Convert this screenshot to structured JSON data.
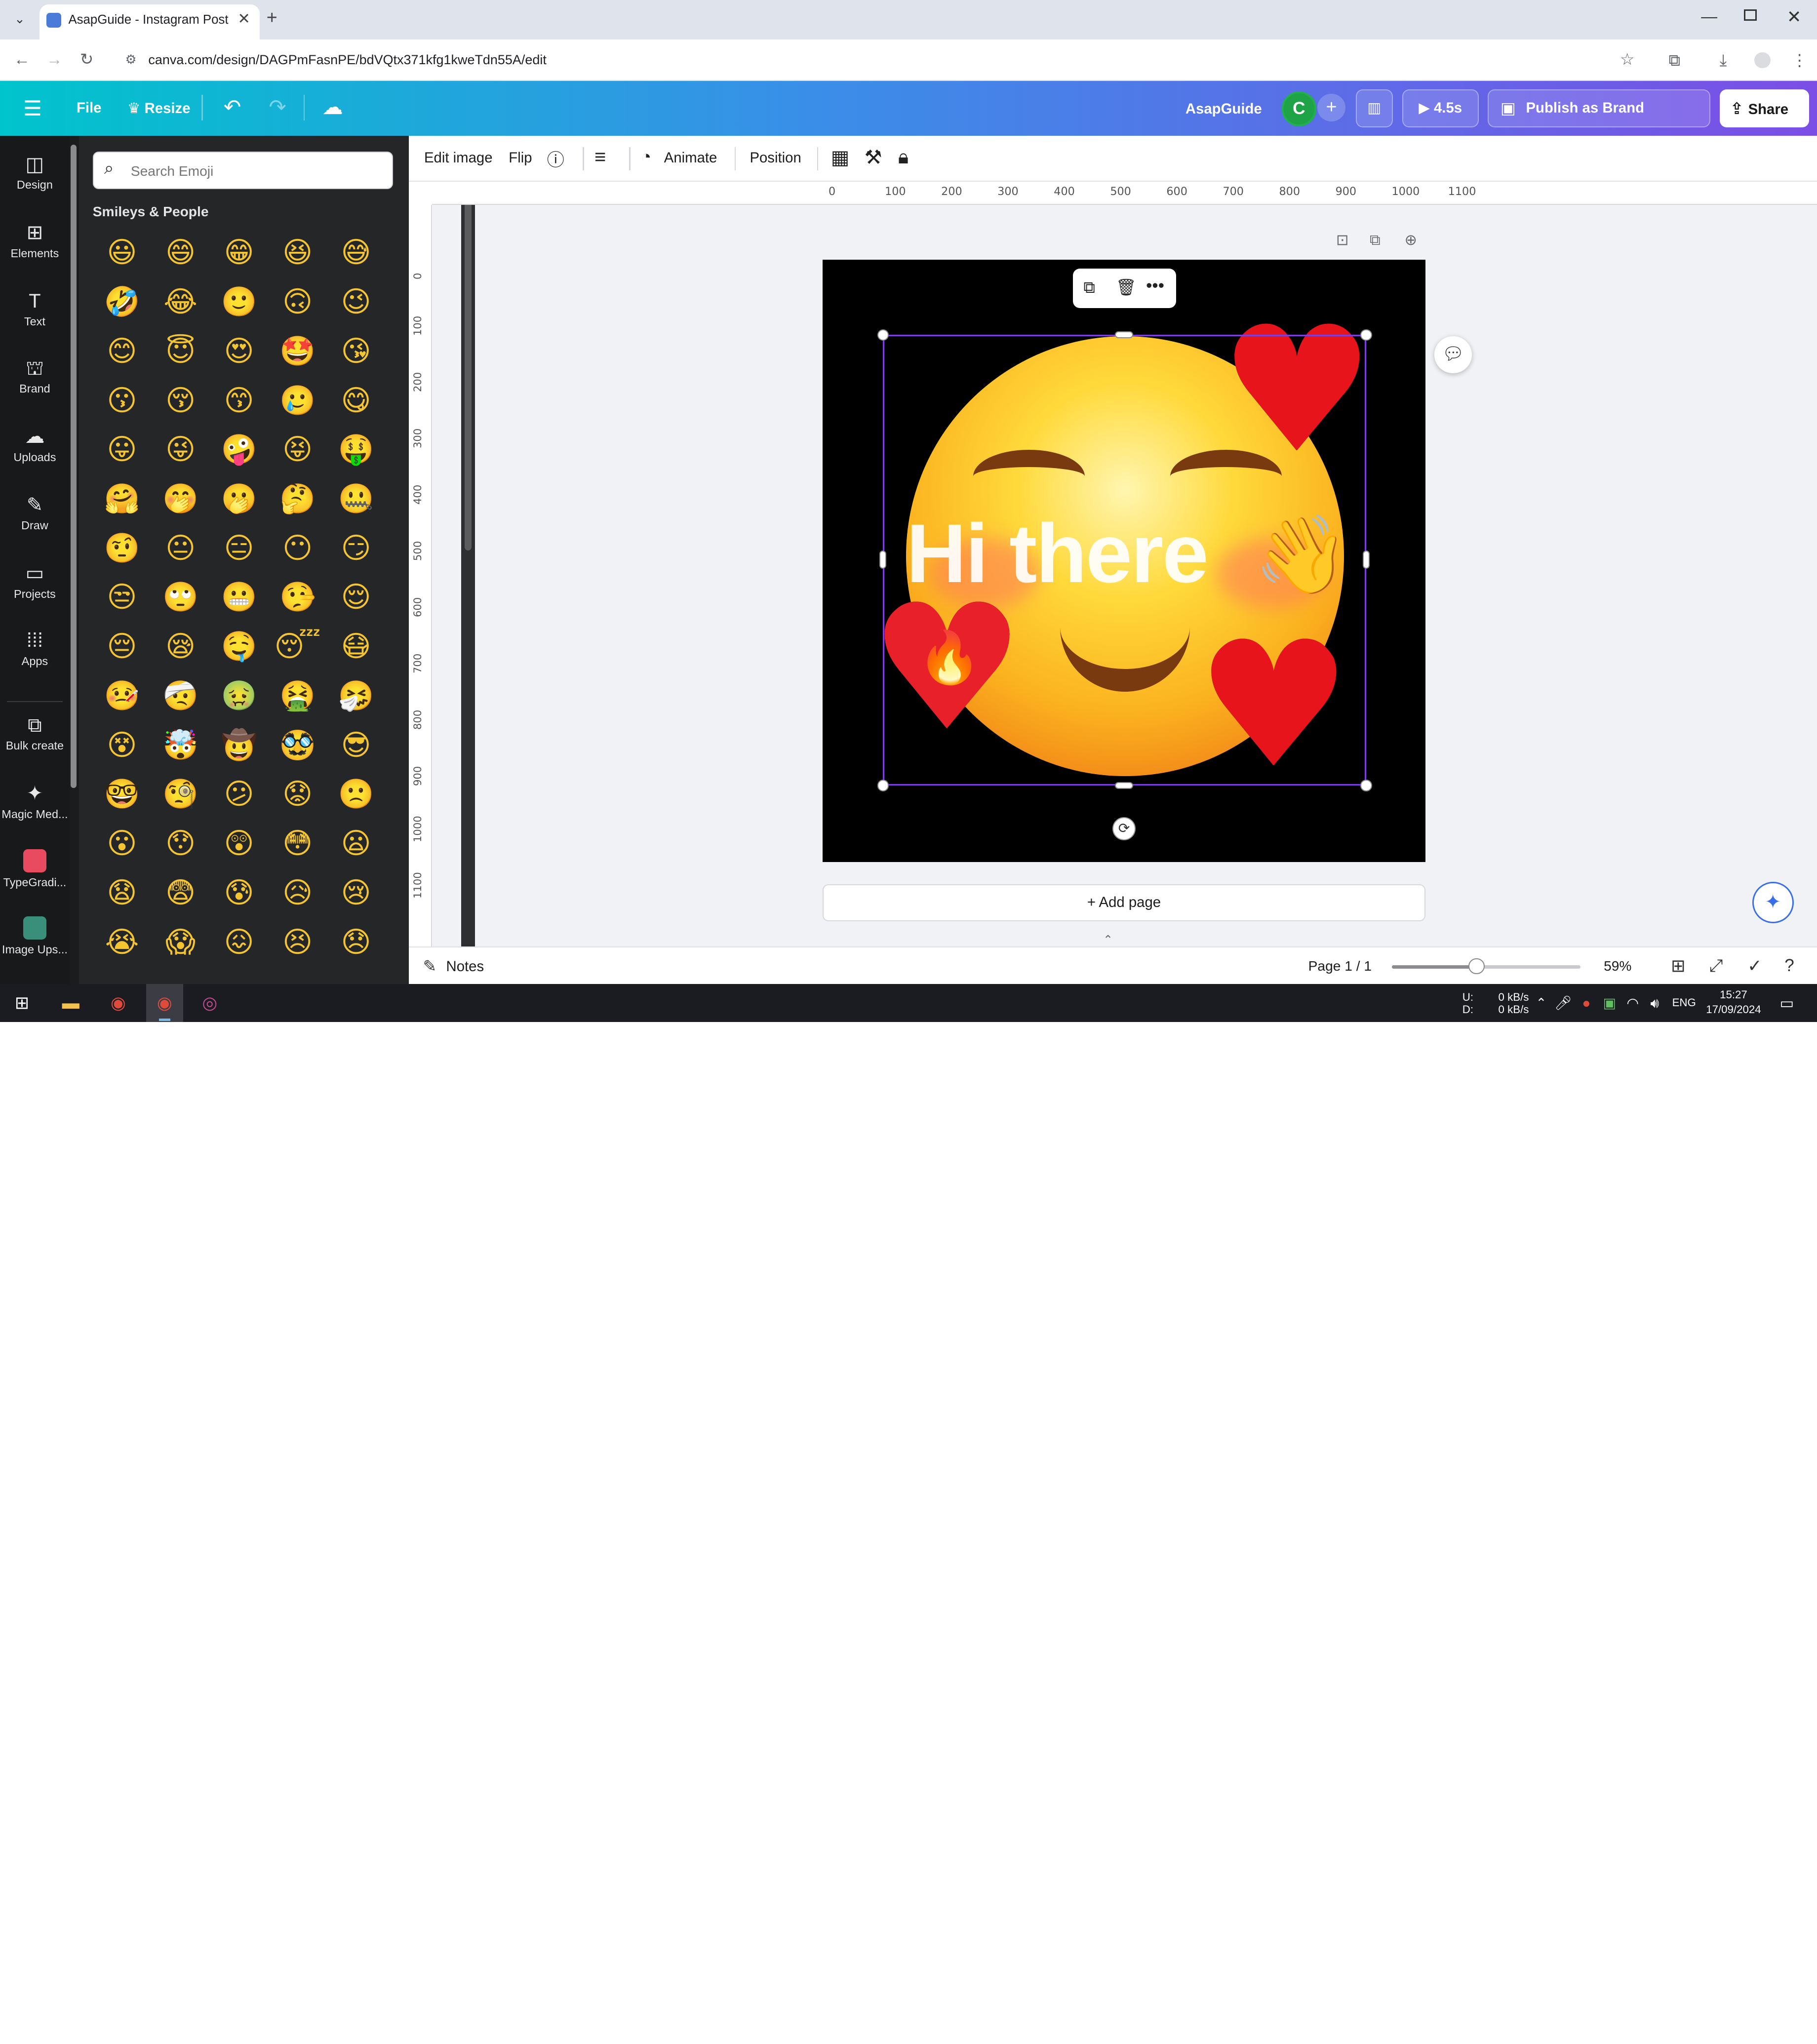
{
  "browser": {
    "tab_title": "AsapGuide - Instagram Post",
    "url": "canva.com/design/DAGPmFasnPE/bdVQtx371kfg1kweTdn55A/edit"
  },
  "header": {
    "file_label": "File",
    "resize_label": "Resize",
    "team_name": "AsapGuide",
    "avatar_letter": "C",
    "play_duration": "4.5s",
    "publish_label": "Publish as Brand Template",
    "share_label": "Share"
  },
  "rail": {
    "items": [
      {
        "label": "Design",
        "icon": "design-icon"
      },
      {
        "label": "Elements",
        "icon": "elements-icon"
      },
      {
        "label": "Text",
        "icon": "text-icon"
      },
      {
        "label": "Brand",
        "icon": "brand-icon"
      },
      {
        "label": "Uploads",
        "icon": "uploads-icon"
      },
      {
        "label": "Draw",
        "icon": "draw-icon"
      },
      {
        "label": "Projects",
        "icon": "projects-icon"
      },
      {
        "label": "Apps",
        "icon": "apps-icon"
      },
      {
        "label": "Bulk create",
        "icon": "bulk-create-icon"
      },
      {
        "label": "Magic Med...",
        "icon": "magic-media-icon"
      },
      {
        "label": "TypeGradi...",
        "icon": "typegradient-app-icon"
      },
      {
        "label": "Image Ups...",
        "icon": "image-upscaler-app-icon"
      }
    ]
  },
  "panel": {
    "search_placeholder": "Search Emoji",
    "section_title": "Smileys & People",
    "emojis": [
      "😃",
      "😄",
      "😁",
      "😆",
      "😅",
      "🤣",
      "😂",
      "🙂",
      "🙃",
      "😉",
      "😊",
      "😇",
      "😍",
      "🤩",
      "😘",
      "😗",
      "😚",
      "😙",
      "🥲",
      "😋",
      "😛",
      "😜",
      "🤪",
      "😝",
      "🤑",
      "🤗",
      "🤭",
      "🫢",
      "🤔",
      "🤐",
      "🤨",
      "😐",
      "😑",
      "😶",
      "😏",
      "😒",
      "🙄",
      "😬",
      "🤥",
      "😌",
      "😔",
      "😪",
      "🤤",
      "😴",
      "😷",
      "🤒",
      "🤕",
      "🤢",
      "🤮",
      "🤧",
      "😵",
      "🤯",
      "🤠",
      "🥸",
      "😎",
      "🤓",
      "🧐",
      "😕",
      "😟",
      "🙁",
      "😮",
      "😯",
      "😲",
      "😳",
      "😦",
      "😧",
      "😨",
      "😰",
      "😥",
      "😢",
      "😭",
      "😱",
      "😖",
      "😣",
      "😞"
    ]
  },
  "toolbar": {
    "edit_image": "Edit image",
    "flip": "Flip",
    "animate": "Animate",
    "position": "Position"
  },
  "rulers": {
    "top": [
      "0",
      "100",
      "200",
      "300",
      "400",
      "500",
      "600",
      "700",
      "800",
      "900",
      "1000",
      "1100"
    ],
    "left": [
      "0",
      "100",
      "200",
      "300",
      "400",
      "500",
      "600",
      "700",
      "800",
      "900",
      "1000",
      "1100"
    ]
  },
  "design": {
    "text": "Hi there",
    "wave_emoji": "👋",
    "fire_emoji": "🔥",
    "heart": "♥"
  },
  "canvas": {
    "add_page": "+ Add page"
  },
  "footer": {
    "notes": "Notes",
    "page_indicator": "Page 1 / 1",
    "zoom": "59%",
    "zoom_fraction": 0.45
  },
  "taskbar": {
    "net_up_label": "U:",
    "net_down_label": "D:",
    "net_up": "0 kB/s",
    "net_down": "0 kB/s",
    "language": "ENG",
    "time": "15:27",
    "date": "17/09/2024"
  }
}
